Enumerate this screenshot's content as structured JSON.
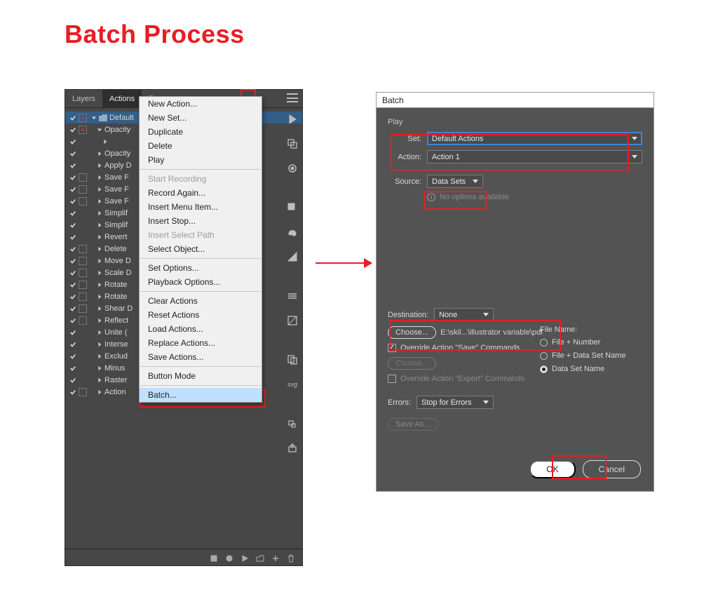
{
  "page_title": "Batch Process",
  "panel": {
    "tabs": [
      "Layers",
      "Actions",
      "Tran"
    ],
    "active_tab": 1,
    "default_set_label": "Default",
    "rows": [
      {
        "label": "Opacity",
        "chk": true,
        "box": "dot",
        "caret": "down",
        "indent": 1
      },
      {
        "label": "",
        "chk": true,
        "box": "none",
        "caret": "right",
        "indent": 2
      },
      {
        "label": "Opacity",
        "chk": true,
        "box": "none",
        "caret": "right",
        "indent": 1
      },
      {
        "label": "Apply D",
        "chk": true,
        "box": "none",
        "caret": "right",
        "indent": 1
      },
      {
        "label": "Save F",
        "chk": true,
        "box": "open",
        "caret": "right",
        "indent": 1
      },
      {
        "label": "Save F",
        "chk": true,
        "box": "open",
        "caret": "right",
        "indent": 1
      },
      {
        "label": "Save F",
        "chk": true,
        "box": "open",
        "caret": "right",
        "indent": 1
      },
      {
        "label": "Simplif",
        "chk": true,
        "box": "none",
        "caret": "right",
        "indent": 1
      },
      {
        "label": "Simplif",
        "chk": true,
        "box": "none",
        "caret": "right",
        "indent": 1
      },
      {
        "label": "Revert",
        "chk": true,
        "box": "none",
        "caret": "right",
        "indent": 1
      },
      {
        "label": "Delete",
        "chk": true,
        "box": "open",
        "caret": "right",
        "indent": 1
      },
      {
        "label": "Move D",
        "chk": true,
        "box": "open",
        "caret": "right",
        "indent": 1
      },
      {
        "label": "Scale D",
        "chk": true,
        "box": "open",
        "caret": "right",
        "indent": 1
      },
      {
        "label": "Rotate",
        "chk": true,
        "box": "open",
        "caret": "right",
        "indent": 1
      },
      {
        "label": "Rotate",
        "chk": true,
        "box": "open",
        "caret": "right",
        "indent": 1
      },
      {
        "label": "Shear D",
        "chk": true,
        "box": "open",
        "caret": "right",
        "indent": 1
      },
      {
        "label": "Reflect",
        "chk": true,
        "box": "open",
        "caret": "right",
        "indent": 1
      },
      {
        "label": "Unite (",
        "chk": true,
        "box": "none",
        "caret": "right",
        "indent": 1
      },
      {
        "label": "Interse",
        "chk": true,
        "box": "none",
        "caret": "right",
        "indent": 1
      },
      {
        "label": "Exclud",
        "chk": true,
        "box": "none",
        "caret": "right",
        "indent": 1
      },
      {
        "label": "Minus",
        "chk": true,
        "box": "none",
        "caret": "right",
        "indent": 1
      },
      {
        "label": "Raster",
        "chk": true,
        "box": "none",
        "caret": "right",
        "indent": 1
      },
      {
        "label": "Action",
        "chk": true,
        "box": "open",
        "caret": "right",
        "indent": 1
      }
    ]
  },
  "flyout": {
    "items": [
      {
        "label": "New Action...",
        "type": "item"
      },
      {
        "label": "New Set...",
        "type": "item"
      },
      {
        "label": "Duplicate",
        "type": "item"
      },
      {
        "label": "Delete",
        "type": "item"
      },
      {
        "label": "Play",
        "type": "item"
      },
      {
        "type": "sep"
      },
      {
        "label": "Start Recording",
        "type": "disabled"
      },
      {
        "label": "Record Again...",
        "type": "item"
      },
      {
        "label": "Insert Menu Item...",
        "type": "item"
      },
      {
        "label": "Insert Stop...",
        "type": "item"
      },
      {
        "label": "Insert Select Path",
        "type": "disabled"
      },
      {
        "label": "Select Object...",
        "type": "item"
      },
      {
        "type": "sep"
      },
      {
        "label": "Set Options...",
        "type": "item"
      },
      {
        "label": "Playback Options...",
        "type": "item"
      },
      {
        "type": "sep"
      },
      {
        "label": "Clear Actions",
        "type": "item"
      },
      {
        "label": "Reset Actions",
        "type": "item"
      },
      {
        "label": "Load Actions...",
        "type": "item"
      },
      {
        "label": "Replace Actions...",
        "type": "item"
      },
      {
        "label": "Save Actions...",
        "type": "item"
      },
      {
        "type": "sep"
      },
      {
        "label": "Button Mode",
        "type": "item"
      },
      {
        "type": "sep"
      },
      {
        "label": "Batch...",
        "type": "hover"
      }
    ]
  },
  "dialog": {
    "title": "Batch",
    "play_label": "Play",
    "set_label": "Set:",
    "set_value": "Default Actions",
    "action_label": "Action:",
    "action_value": "Action 1",
    "source_label": "Source:",
    "source_value": "Data Sets",
    "no_options": "No options available",
    "destination_label": "Destination:",
    "destination_value": "None",
    "choose_label": "Choose...",
    "path_text": "E:\\skil...\\illustrator variable\\pdf",
    "override_save": "Override Action \"Save\" Commands",
    "override_export": "Override Action \"Export\" Commands",
    "file_name_label": "File Name:",
    "fn_opt1": "File + Number",
    "fn_opt2": "File + Data Set Name",
    "fn_opt3": "Data Set Name",
    "errors_label": "Errors:",
    "errors_value": "Stop for Errors",
    "save_as": "Save As...",
    "ok": "OK",
    "cancel": "Cancel"
  }
}
